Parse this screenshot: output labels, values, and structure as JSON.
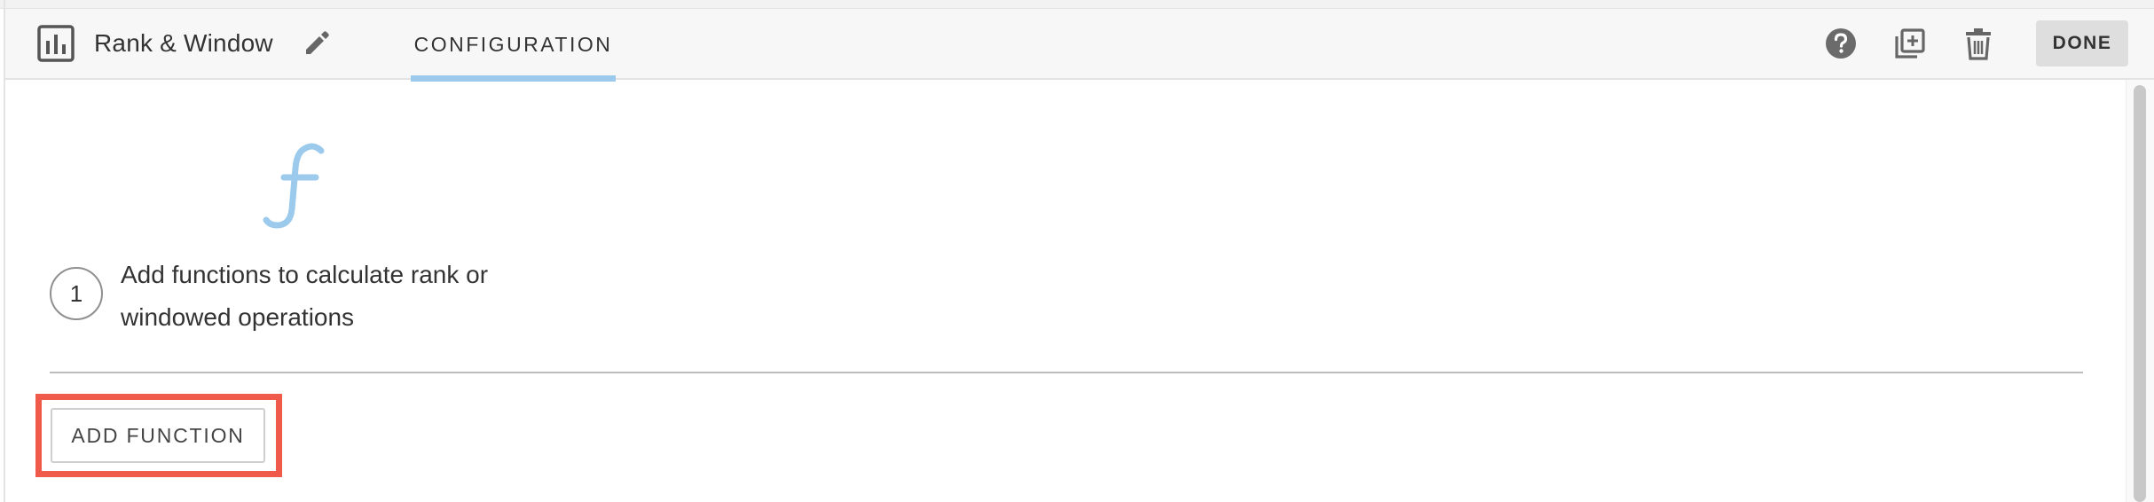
{
  "header": {
    "step_title": "Rank & Window",
    "tab_label": "CONFIGURATION",
    "done_label": "DONE",
    "icons": {
      "chart": "bar-chart-icon",
      "edit": "pencil-icon",
      "help": "help-icon",
      "duplicate": "copy-icon",
      "delete": "trash-icon"
    }
  },
  "main": {
    "function_icon": "function-icon",
    "hint": {
      "number": "1",
      "line1": "Add functions to calculate rank or",
      "line2": "windowed operations"
    },
    "add_function_label": "ADD FUNCTION"
  },
  "colors": {
    "accent": "#9ccaec",
    "highlight": "#ef5a4a",
    "header_bg": "#f7f7f7",
    "done_bg": "#dedede"
  }
}
